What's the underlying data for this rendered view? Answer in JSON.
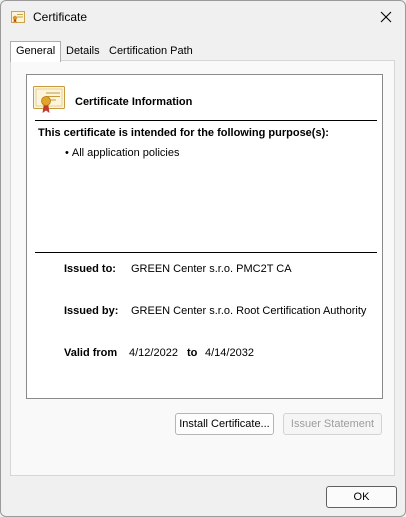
{
  "window": {
    "title": "Certificate",
    "close_label": "Close"
  },
  "tabs": [
    {
      "label": "General",
      "active": true
    },
    {
      "label": "Details",
      "active": false
    },
    {
      "label": "Certification Path",
      "active": false
    }
  ],
  "general": {
    "heading": "Certificate Information",
    "purpose_heading": "This certificate is intended for the following purpose(s):",
    "purposes": [
      "All application policies"
    ],
    "issued_to_label": "Issued to:",
    "issued_to_value": "GREEN Center s.r.o. PMC2T CA",
    "issued_by_label": "Issued by:",
    "issued_by_value": "GREEN Center s.r.o. Root Certification Authority",
    "valid_from_label": "Valid from",
    "valid_from_value": "4/12/2022",
    "valid_to_label": "to",
    "valid_to_value": "4/14/2032"
  },
  "buttons": {
    "install_certificate": "Install Certificate...",
    "issuer_statement": "Issuer Statement",
    "ok": "OK"
  },
  "colors": {
    "window_bg": "#f0f0f0",
    "panel_bg": "#f9f9f9",
    "content_bg": "#ffffff",
    "disabled_text": "#9d9d9d"
  }
}
